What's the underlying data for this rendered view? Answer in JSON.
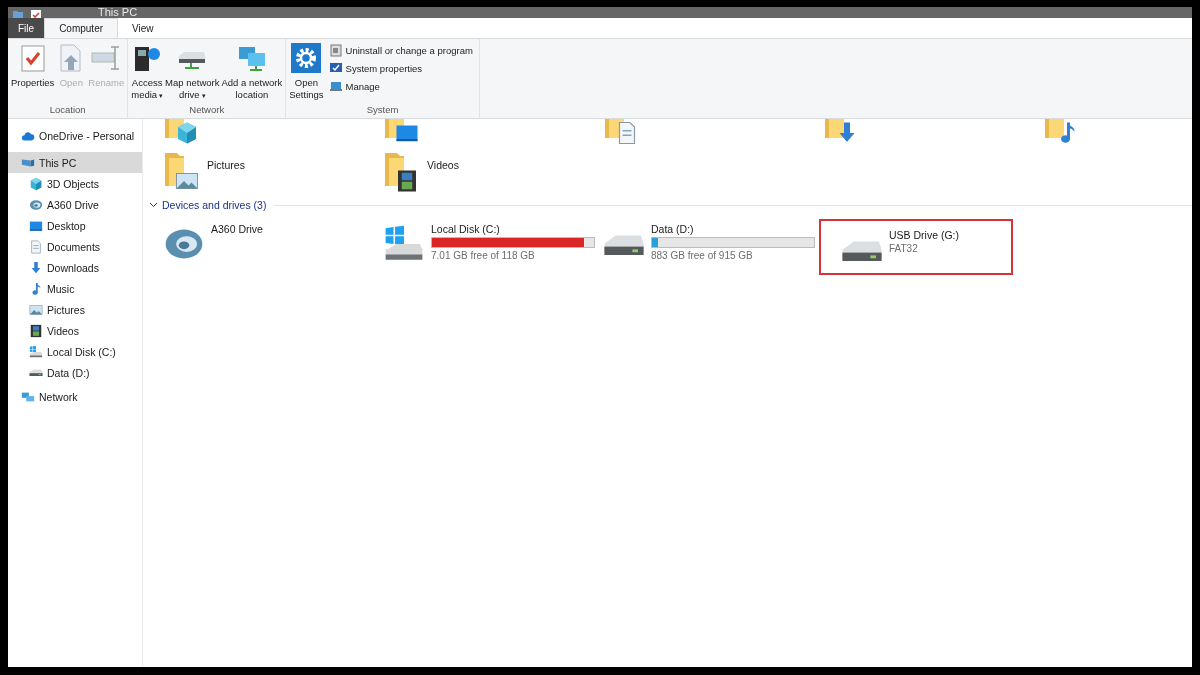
{
  "window": {
    "title": "This PC"
  },
  "tabs": [
    {
      "label": "File",
      "selected": false,
      "kind": "file"
    },
    {
      "label": "Computer",
      "selected": true,
      "kind": "tab"
    },
    {
      "label": "View",
      "selected": false,
      "kind": "tab"
    }
  ],
  "ribbon": {
    "groups": [
      {
        "label": "Location",
        "buttons": [
          {
            "kind": "properties",
            "lines": [
              "Properties"
            ],
            "disabled": false
          },
          {
            "kind": "open",
            "lines": [
              "Open"
            ],
            "disabled": true
          },
          {
            "kind": "rename",
            "lines": [
              "Rename"
            ],
            "disabled": true
          }
        ]
      },
      {
        "label": "Network",
        "buttons": [
          {
            "kind": "media",
            "lines": [
              "Access",
              "media"
            ],
            "disabled": false,
            "caret": "▾"
          },
          {
            "kind": "mapdrive",
            "lines": [
              "Map network",
              "drive"
            ],
            "disabled": false,
            "caret": "▾"
          },
          {
            "kind": "netloc",
            "lines": [
              "Add a network",
              "location"
            ],
            "disabled": false
          }
        ]
      },
      {
        "label": "System",
        "buttons": [
          {
            "kind": "settings",
            "lines": [
              "Open",
              "Settings"
            ],
            "disabled": false
          }
        ],
        "small_buttons": [
          {
            "kind": "uninstall",
            "label": "Uninstall or change a program"
          },
          {
            "kind": "sysprops",
            "label": "System properties"
          },
          {
            "kind": "manage",
            "label": "Manage"
          }
        ]
      }
    ]
  },
  "sidebar": {
    "items": [
      {
        "label": "OneDrive - Personal",
        "kind": "cloud",
        "selected": false
      },
      {
        "label": "This PC",
        "kind": "pc",
        "selected": true,
        "children": [
          {
            "label": "3D Objects",
            "kind": "cube",
            "selected": false
          },
          {
            "label": "A360 Drive",
            "kind": "a360",
            "selected": false
          },
          {
            "label": "Desktop",
            "kind": "desktop",
            "selected": false
          },
          {
            "label": "Documents",
            "kind": "documents",
            "selected": false
          },
          {
            "label": "Downloads",
            "kind": "downloads",
            "selected": false
          },
          {
            "label": "Music",
            "kind": "music",
            "selected": false
          },
          {
            "label": "Pictures",
            "kind": "pictures",
            "selected": false
          },
          {
            "label": "Videos",
            "kind": "videos",
            "selected": false
          },
          {
            "label": "Local Disk (C:)",
            "kind": "windisk",
            "selected": false
          },
          {
            "label": "Data (D:)",
            "kind": "disk",
            "selected": false
          }
        ]
      },
      {
        "label": "Network",
        "kind": "network",
        "selected": false
      }
    ]
  },
  "folders": {
    "hidden_row": [
      {
        "kind": "cube"
      },
      {
        "kind": "desktop"
      },
      {
        "kind": "documents"
      },
      {
        "kind": "downloads"
      },
      {
        "kind": "music"
      }
    ],
    "items": [
      {
        "label": "Pictures",
        "kind": "pictures"
      },
      {
        "label": "Videos",
        "kind": "videos"
      }
    ]
  },
  "devices": {
    "heading": "Devices and drives (3)",
    "expanded": true,
    "items": [
      {
        "name": "A360 Drive",
        "kind": "a360",
        "highlighted": false
      },
      {
        "name": "Local Disk (C:)",
        "kind": "windisk",
        "level": 0.94,
        "color": "#da2626",
        "detail": "7.01 GB free of 118 GB",
        "highlighted": false
      },
      {
        "name": "Data (D:)",
        "kind": "disk",
        "level": 0.035,
        "color": "#26a0da",
        "detail": "883 GB free of 915 GB",
        "highlighted": false
      },
      {
        "name": "USB Drive (G:)",
        "kind": "usb",
        "detail": "FAT32",
        "highlighted": true
      }
    ]
  }
}
